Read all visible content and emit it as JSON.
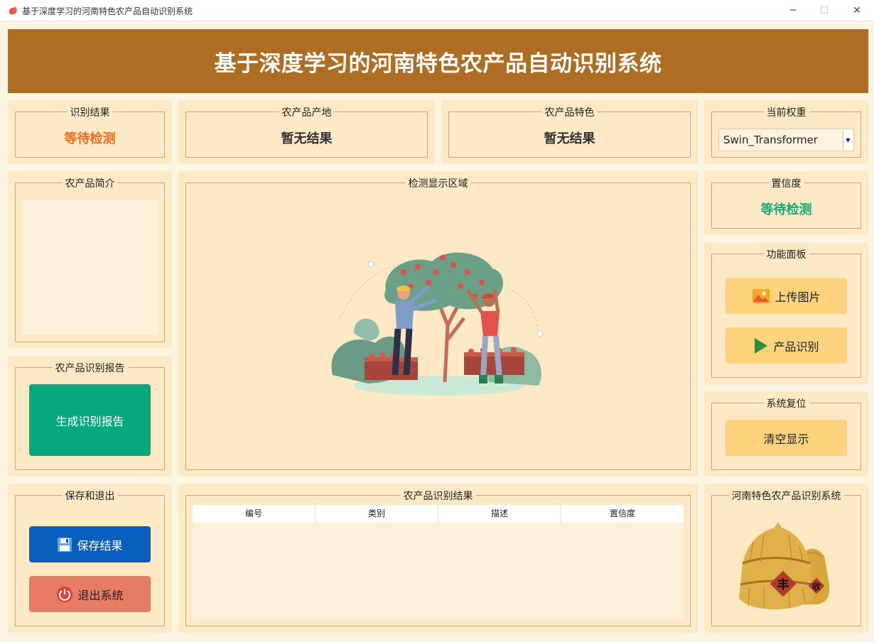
{
  "window": {
    "title": "基于深度学习的河南特色农产品自动识别系统",
    "min_label": "─",
    "max_label": "☐",
    "close_label": "✕"
  },
  "header": {
    "title": "基于深度学习的河南特色农产品自动识别系统"
  },
  "result": {
    "title": "识别结果",
    "value": "等待检测"
  },
  "origin": {
    "title": "农产品产地",
    "value": "暂无结果"
  },
  "feature": {
    "title": "农产品特色",
    "value": "暂无结果"
  },
  "weights": {
    "title": "当前权重",
    "selected": "Swin_Transformer"
  },
  "intro": {
    "title": "农产品简介",
    "content": ""
  },
  "display": {
    "title": "检测显示区域"
  },
  "confidence": {
    "title": "置信度",
    "value": "等待检测"
  },
  "functions": {
    "title": "功能面板",
    "upload_label": "上传图片",
    "recognize_label": "产品识别"
  },
  "reset": {
    "title": "系统复位",
    "clear_label": "清空显示"
  },
  "report": {
    "title": "农产品识别报告",
    "button_label": "生成识别报告"
  },
  "save_exit": {
    "title": "保存和退出",
    "save_label": "保存结果",
    "exit_label": "退出系统"
  },
  "results_table": {
    "title": "农产品识别结果",
    "columns": [
      "编号",
      "类别",
      "描述",
      "置信度"
    ],
    "rows": []
  },
  "brand": {
    "title": "河南特色农产品识别系统",
    "sign1": "丰",
    "sign2": "收"
  },
  "colors": {
    "header_bg": "#ad6e23",
    "result_text": "#f06c1a",
    "confidence_text": "#17a77a",
    "report_button": "#07a97c",
    "save_button": "#0b5ebb",
    "exit_button": "#e87b64",
    "function_button": "#fdd37d"
  }
}
